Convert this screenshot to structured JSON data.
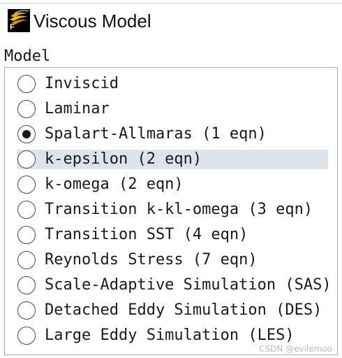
{
  "window": {
    "title": "Viscous Model",
    "icon": "fluent-app-icon",
    "icon_letter": "F"
  },
  "model": {
    "group_label": "Model",
    "selected": "Spalart-Allmaras (1 eqn)",
    "hovered": "k-epsilon (2 eqn)",
    "options": [
      {
        "label": "Inviscid",
        "checked": false
      },
      {
        "label": "Laminar",
        "checked": false
      },
      {
        "label": "Spalart-Allmaras (1 eqn)",
        "checked": true
      },
      {
        "label": "k-epsilon (2 eqn)",
        "checked": false
      },
      {
        "label": "k-omega (2 eqn)",
        "checked": false
      },
      {
        "label": "Transition k-kl-omega (3 eqn)",
        "checked": false
      },
      {
        "label": "Transition SST (4 eqn)",
        "checked": false
      },
      {
        "label": "Reynolds Stress (7 eqn)",
        "checked": false
      },
      {
        "label": "Scale-Adaptive Simulation (SAS)",
        "checked": false
      },
      {
        "label": "Detached Eddy Simulation (DES)",
        "checked": false
      },
      {
        "label": "Large Eddy Simulation (LES)",
        "checked": false
      }
    ]
  },
  "watermark": "CSDN @evilemoo",
  "colors": {
    "hover_bg": "#dde3ea",
    "icon_bg": "#000000",
    "icon_accent": "#e8a317"
  }
}
